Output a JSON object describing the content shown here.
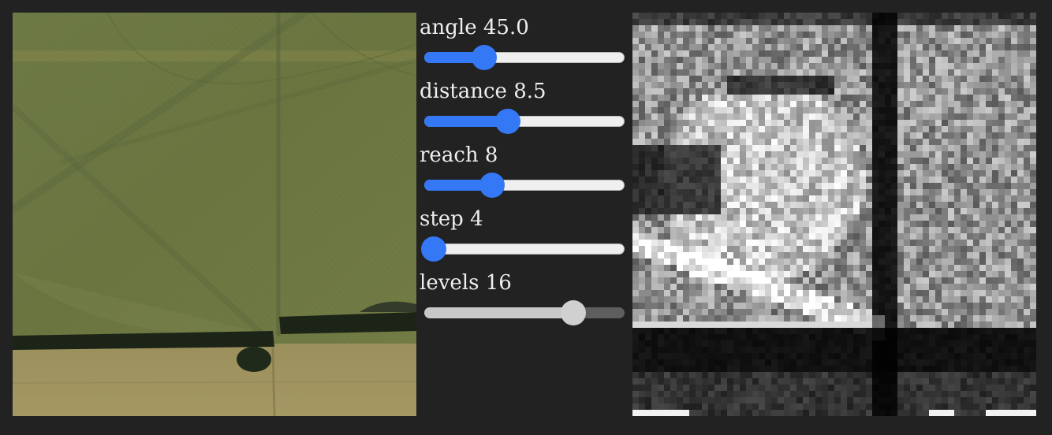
{
  "controls": [
    {
      "label": "angle 45.0",
      "name": "angle",
      "value": 45.0,
      "min": 0,
      "max": 180,
      "fraction": 0.28,
      "disabled": false
    },
    {
      "label": "distance 8.5",
      "name": "distance",
      "value": 8.5,
      "min": 1,
      "max": 24,
      "fraction": 0.41,
      "disabled": false
    },
    {
      "label": "reach 8",
      "name": "reach",
      "value": 8,
      "min": 1,
      "max": 24,
      "fraction": 0.32,
      "disabled": false
    },
    {
      "label": "step 4",
      "name": "step",
      "value": 4,
      "min": 4,
      "max": 64,
      "fraction": 0.0,
      "disabled": false
    },
    {
      "label": "levels 16",
      "name": "levels",
      "value": 16,
      "min": 2,
      "max": 20,
      "fraction": 0.77,
      "disabled": true
    }
  ],
  "colors": {
    "background": "#222222",
    "accent": "#3478f6",
    "label": "#eeeeee"
  }
}
